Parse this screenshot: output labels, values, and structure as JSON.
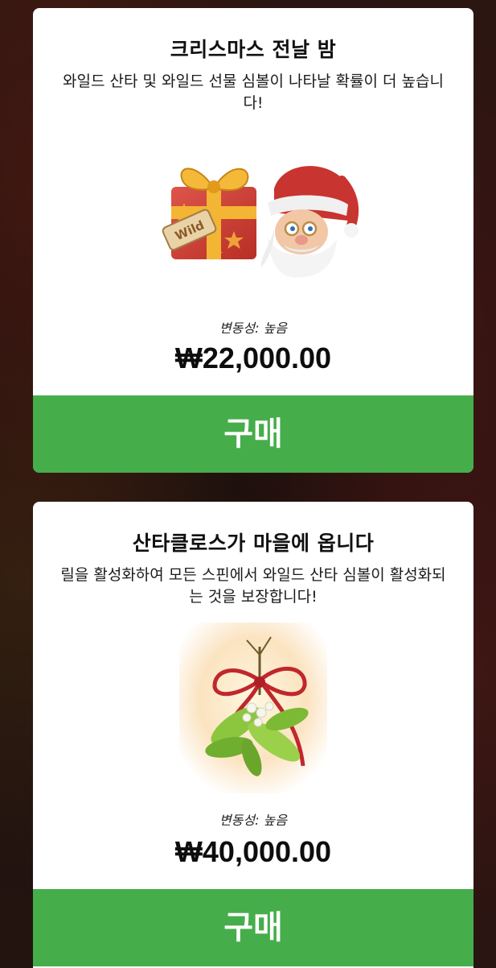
{
  "offers": [
    {
      "title": "크리스마스 전날 밤",
      "description": "와일드 산타 및 와일드 선물 심볼이 나타날 확률이 더 높습니다!",
      "art_icons": [
        "gift-box-icon",
        "santa-face-icon"
      ],
      "gift_tag_text": "Wild",
      "volatility": "변동성: 높음",
      "price": "₩22,000.00",
      "buy_label": "구매"
    },
    {
      "title": "산타클로스가 마을에 옵니다",
      "description": "릴을 활성화하여 모든 스핀에서 와일드 산타 심볼이 활성화되는 것을 보장합니다!",
      "art_icons": [
        "mistletoe-icon"
      ],
      "volatility": "변동성: 높음",
      "price": "₩40,000.00",
      "buy_label": "구매"
    }
  ],
  "colors": {
    "card_background": "#ffffff",
    "buy_button": "#46ad4b",
    "buy_text": "#ffffff",
    "page_background": "#1c100d"
  }
}
